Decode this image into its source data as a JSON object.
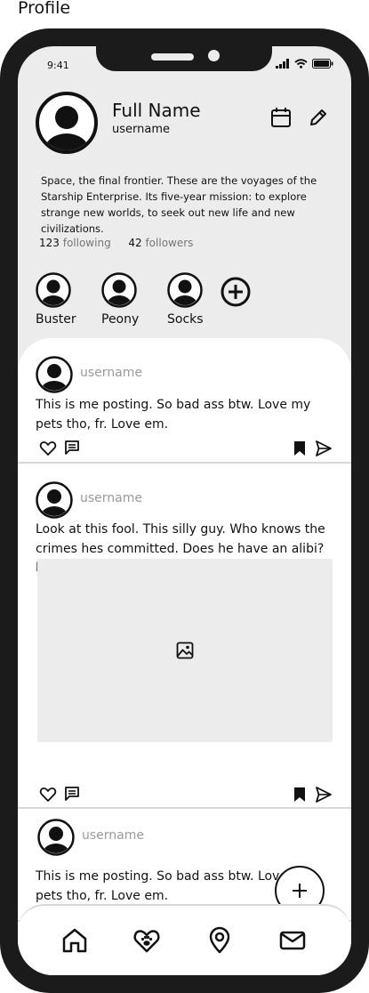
{
  "page_title": "Profile",
  "status_bar": {
    "time": "9:41"
  },
  "profile": {
    "full_name": "Full Name",
    "username": "username",
    "bio": "Space, the final frontier. These are the voyages of the Starship Enterprise. Its five-year mission: to explore strange new worlds, to seek out new life and new civilizations.",
    "following_count": "123",
    "following_label": "following",
    "followers_count": "42",
    "followers_label": "followers"
  },
  "pets": [
    {
      "name": "Buster"
    },
    {
      "name": "Peony"
    },
    {
      "name": "Socks"
    }
  ],
  "posts": [
    {
      "username": "username",
      "text": "This is me posting. So bad ass btw. Love my pets tho, fr. Love em."
    },
    {
      "username": "username",
      "text": "Look at this fool. This silly guy. Who knows the crimes hes committed. Does he have an alibi? Doesn't matter."
    },
    {
      "username": "username",
      "text": "This is me posting. So bad ass btw. Love my pets tho, fr. Love em."
    }
  ],
  "icons": {
    "header": [
      "calendar-icon",
      "edit-pencil-icon"
    ],
    "post_actions": [
      "heart-icon",
      "comment-icon",
      "bookmark-icon",
      "send-icon"
    ],
    "nav": [
      "home-icon",
      "paw-heart-icon",
      "location-pin-icon",
      "mail-icon"
    ],
    "fab": "plus-icon"
  }
}
